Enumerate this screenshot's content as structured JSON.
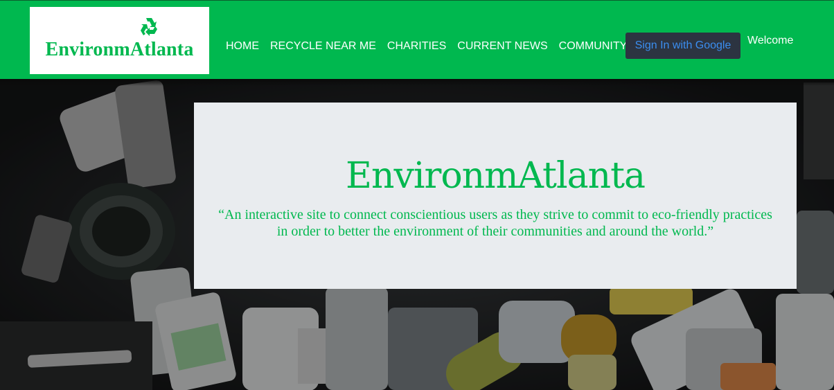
{
  "brand": {
    "logo_text": "EnvironmAtlanta",
    "logo_icon": "recycle-icon",
    "brand_color": "#00b84f"
  },
  "nav": {
    "items": [
      {
        "label": "HOME"
      },
      {
        "label": "RECYCLE NEAR ME"
      },
      {
        "label": "CHARITIES"
      },
      {
        "label": "CURRENT NEWS"
      },
      {
        "label": "COMMUNITY"
      }
    ],
    "signin_label": "Sign In with Google",
    "welcome_text": "Welcome"
  },
  "hero": {
    "title": "EnvironmAtlanta",
    "quote": "“An interactive site to connect conscientious users as they strive to commit to eco-friendly practices in order to better the environment of their communities and around the world.”",
    "background": "dark photo of discarded plastic bottles and containers",
    "panel_color": "#e9ecef"
  }
}
